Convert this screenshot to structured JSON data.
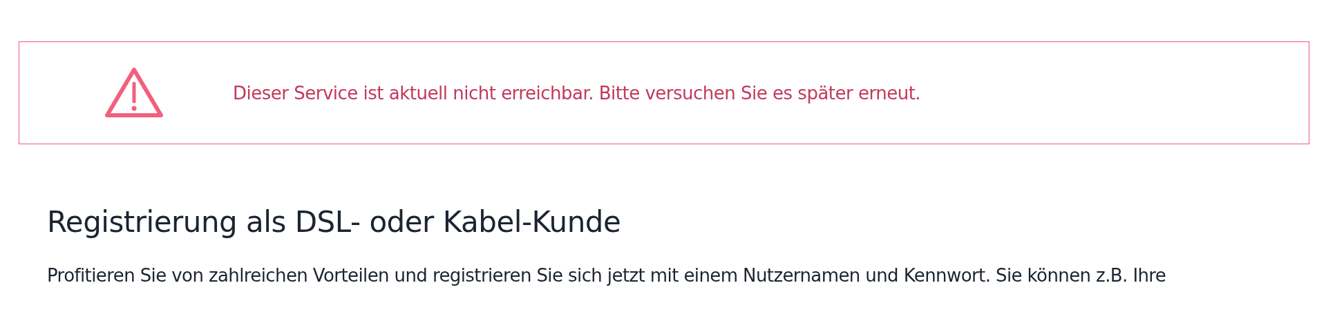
{
  "alert": {
    "kind": "error",
    "message": "Dieser Service ist aktuell nicht erreichbar. Bitte versuchen Sie es später erneut."
  },
  "heading": "Registrierung als DSL- oder Kabel-Kunde",
  "intro": "Profitieren Sie von zahlreichen Vorteilen und registrieren Sie sich jetzt mit einem Nutzernamen und Kennwort. Sie können z.B. Ihre"
}
